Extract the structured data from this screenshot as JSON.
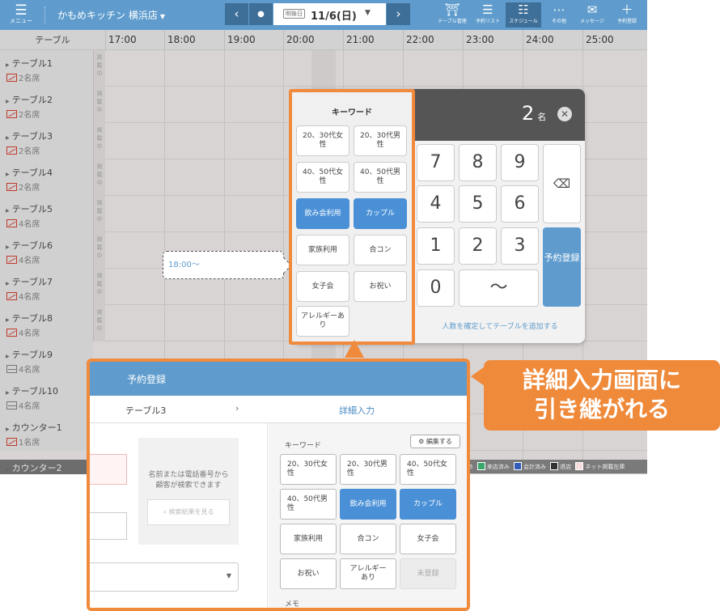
{
  "topbar": {
    "menu_icon": "hamburger-icon",
    "menu_label": "メニュー",
    "store_name": "かもめキッチン 横浜店",
    "prev_icon": "chevron-left-icon",
    "today_icon": "dot-icon",
    "next_icon": "chevron-right-icon",
    "date_badge": "明後日",
    "date": "11/6(日)",
    "tools": [
      {
        "icon": "table-icon",
        "label": "テーブル管理"
      },
      {
        "icon": "list-icon",
        "label": "予約リスト"
      },
      {
        "icon": "schedule-icon",
        "label": "スケジュール"
      },
      {
        "icon": "more-icon",
        "label": "その他"
      },
      {
        "icon": "envelope-icon",
        "label": "メッセージ"
      },
      {
        "icon": "plus-icon",
        "label": "予約登録"
      }
    ]
  },
  "timeline": {
    "column_header": "テーブル",
    "hours": [
      "17:00",
      "18:00",
      "19:00",
      "20:00",
      "21:00",
      "22:00",
      "23:00",
      "24:00",
      "25:00"
    ],
    "tag_text": "掲載中",
    "rows": [
      {
        "name": "テーブル1",
        "seats": "2名席",
        "icon": "no-smoking-icon"
      },
      {
        "name": "テーブル2",
        "seats": "2名席",
        "icon": "no-smoking-icon"
      },
      {
        "name": "テーブル3",
        "seats": "2名席",
        "icon": "no-smoking-icon"
      },
      {
        "name": "テーブル4",
        "seats": "2名席",
        "icon": "no-smoking-icon"
      },
      {
        "name": "テーブル5",
        "seats": "4名席",
        "icon": "no-smoking-icon"
      },
      {
        "name": "テーブル6",
        "seats": "4名席",
        "icon": "no-smoking-icon"
      },
      {
        "name": "テーブル7",
        "seats": "4名席",
        "icon": "no-smoking-icon"
      },
      {
        "name": "テーブル8",
        "seats": "4名席",
        "icon": "no-smoking-icon"
      },
      {
        "name": "テーブル9",
        "seats": "4名席",
        "icon": "smoking-icon"
      },
      {
        "name": "テーブル10",
        "seats": "4名席",
        "icon": "smoking-icon"
      },
      {
        "name": "カウンター1",
        "seats": "1名席",
        "icon": "no-smoking-icon"
      },
      {
        "name": "カウンター2",
        "seats": "",
        "icon": ""
      }
    ],
    "slot_time": "18:00〜"
  },
  "legend": {
    "prefix": "5",
    "items": [
      {
        "label": "来店済み",
        "color": "#3aa76d"
      },
      {
        "label": "会計済み",
        "color": "#2f5db8"
      },
      {
        "label": "退店",
        "color": "#333333"
      },
      {
        "label": "ネット掲載在庫",
        "color": "#f6dede"
      }
    ]
  },
  "keypad": {
    "count": "2",
    "count_unit": "名",
    "close_icon": "close-icon",
    "keys": [
      "7",
      "8",
      "9",
      "4",
      "5",
      "6",
      "1",
      "2",
      "3",
      "0",
      "〜"
    ],
    "backspace_icon": "backspace-icon",
    "register_label": "予約登録",
    "note": "人数を確定してテーブルを追加する"
  },
  "keyword_panel": {
    "title": "キーワード",
    "items": [
      {
        "label": "20、30代女性",
        "selected": false
      },
      {
        "label": "20、30代男性",
        "selected": false
      },
      {
        "label": "40、50代女性",
        "selected": false
      },
      {
        "label": "40、50代男性",
        "selected": false
      },
      {
        "label": "飲み会利用",
        "selected": true
      },
      {
        "label": "カップル",
        "selected": true
      },
      {
        "label": "家族利用",
        "selected": false
      },
      {
        "label": "合コン",
        "selected": false
      },
      {
        "label": "女子会",
        "selected": false
      },
      {
        "label": "お祝い",
        "selected": false
      },
      {
        "label": "アレルギーあり",
        "selected": false
      }
    ]
  },
  "detail": {
    "title": "予約登録",
    "table": "テーブル3",
    "chevron": "›",
    "tab": "詳細入力",
    "search_hint_1": "名前または電話番号から",
    "search_hint_2": "顧客が検索できます",
    "search_button": "検索結果を見る",
    "search_icon": "search-icon",
    "keyword_label": "キーワード",
    "edit_label": "編集する",
    "edit_icon": "gear-icon",
    "keywords": [
      {
        "label": "20、30代女性",
        "state": "normal"
      },
      {
        "label": "20、30代男性",
        "state": "normal"
      },
      {
        "label": "40、50代女性",
        "state": "normal"
      },
      {
        "label": "40、50代男性",
        "state": "normal"
      },
      {
        "label": "飲み会利用",
        "state": "selected"
      },
      {
        "label": "カップル",
        "state": "selected"
      },
      {
        "label": "家族利用",
        "state": "normal"
      },
      {
        "label": "合コン",
        "state": "normal"
      },
      {
        "label": "女子会",
        "state": "normal"
      },
      {
        "label": "お祝い",
        "state": "normal"
      },
      {
        "label": "アレルギーあり",
        "state": "normal"
      },
      {
        "label": "未登録",
        "state": "disabled"
      }
    ],
    "memo_label": "メモ"
  },
  "callout": {
    "line1": "詳細入力画面に",
    "line2": "引き継がれる"
  }
}
